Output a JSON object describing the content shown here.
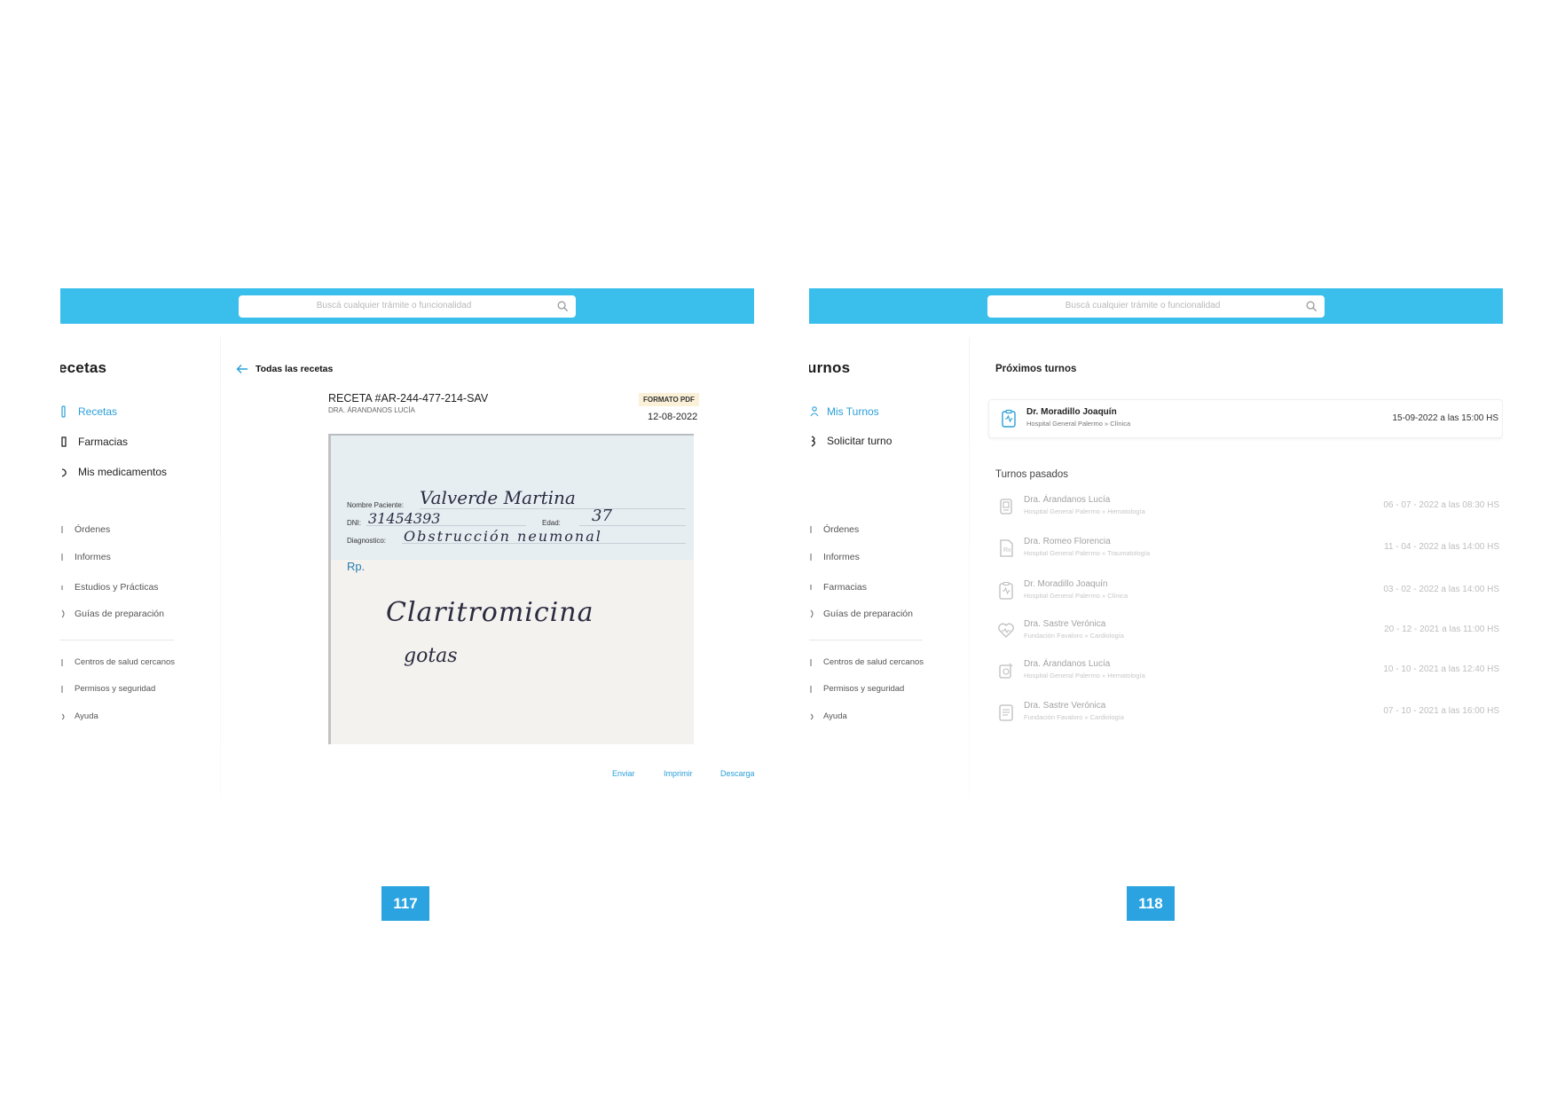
{
  "search": {
    "placeholder": "Buscá cualquier trámite o funcionalidad"
  },
  "left": {
    "section_title": "ecetas",
    "nav": [
      {
        "label": "Recetas",
        "icon": "prescription-icon",
        "active": true
      },
      {
        "label": "Farmacias",
        "icon": "pharmacy-icon",
        "active": false
      },
      {
        "label": "Mis medicamentos",
        "icon": "medication-icon",
        "active": false
      }
    ],
    "secondary_nav": [
      "Órdenes",
      "Informes",
      "Estudios y Prácticas",
      "Guías de preparación"
    ],
    "tertiary_nav": [
      "Centros de salud cercanos",
      "Permisos y seguridad",
      "Ayuda"
    ],
    "back_label": "Todas las recetas",
    "prescription": {
      "title": "RECETA #AR-244-477-214-SAV",
      "doctor": "DRA. ÁRANDANOS LUCÍA",
      "badge": "FORMATO PDF",
      "date": "12-08-2022",
      "form": {
        "patient_label": "Nombre Paciente:",
        "patient_value": "Valverde Martina",
        "dni_label": "DNI:",
        "dni_value": "31454393",
        "age_label": "Edad:",
        "age_value": "37",
        "diagnosis_label": "Diagnostico:",
        "diagnosis_value": "Obstrucción neumonal",
        "rp_label": "Rp.",
        "rx_line1": "Claritromicina",
        "rx_line2": "gotas"
      }
    },
    "actions": [
      "Enviar",
      "Imprimir",
      "Descargar"
    ],
    "page_number": "117"
  },
  "right": {
    "section_title": "urnos",
    "nav": [
      {
        "label": "Mis Turnos",
        "icon": "calendar-user-icon",
        "active": true
      },
      {
        "label": "Solicitar turno",
        "icon": "request-appointment-icon",
        "active": false
      }
    ],
    "secondary_nav": [
      "Órdenes",
      "Informes",
      "Farmacias",
      "Guías de preparación"
    ],
    "tertiary_nav": [
      "Centros de salud cercanos",
      "Permisos y seguridad",
      "Ayuda"
    ],
    "upcoming_title": "Próximos turnos",
    "upcoming": {
      "doctor": "Dr. Moradillo Joaquín",
      "place": "Hospital General Palermo » Clínica",
      "date": "15-09-2022 a las 15:00 HS"
    },
    "past_title": "Turnos pasados",
    "past": [
      {
        "doctor": "Dra. Árandanos Lucía",
        "place": "Hospital General Palermo » Hematología",
        "date": "06 - 07 - 2022 a las 08:30 HS",
        "icon": "lab-test-icon"
      },
      {
        "doctor": "Dra. Romeo Florencia",
        "place": "Hospital General Palermo » Traumatología",
        "date": "11 - 04 - 2022 a las 14:00 HS",
        "icon": "prescription-doc-icon"
      },
      {
        "doctor": "Dr. Moradillo Joaquín",
        "place": "Hospital General Palermo » Clínica",
        "date": "03 - 02 - 2022 a las 14:00 HS",
        "icon": "clipboard-icon"
      },
      {
        "doctor": "Dra. Sastre Verónica",
        "place": "Fundación Favaloro » Cardiología",
        "date": "20 - 12 - 2021 a las 11:00 HS",
        "icon": "heart-icon"
      },
      {
        "doctor": "Dra. Árandanos Lucía",
        "place": "Hospital General Palermo » Hematología",
        "date": "10 - 10 - 2021 a las 12:40 HS",
        "icon": "microscope-icon"
      },
      {
        "doctor": "Dra. Sastre Verónica",
        "place": "Fundación Favaloro » Cardiología",
        "date": "07 - 10 - 2021 a las 16:00 HS",
        "icon": "report-icon"
      }
    ],
    "page_number": "118"
  },
  "colors": {
    "accent": "#3abfec",
    "link": "#2a9fd8",
    "badge_bg": "#fbf1d8",
    "page_badge": "#2aa3e0"
  }
}
